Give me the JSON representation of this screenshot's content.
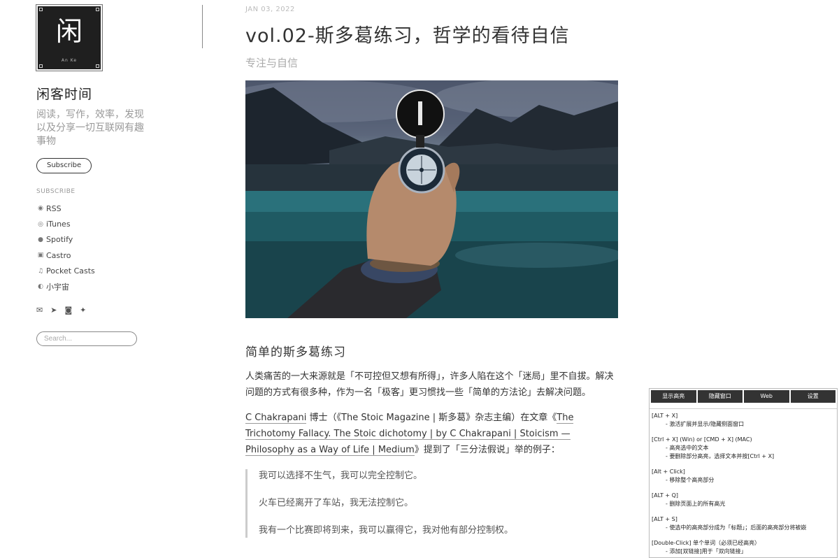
{
  "sidebar": {
    "logo": {
      "glyph": "闲",
      "sub": "An Ke"
    },
    "site_title": "闲客时间",
    "site_description": "阅读，写作，效率，发现以及分享一切互联网有趣事物",
    "subscribe_button": "Subscribe",
    "subscribe_heading": "SUBSCRIBE",
    "subscribe_links": [
      {
        "label": "RSS",
        "icon": "rss-icon"
      },
      {
        "label": "iTunes",
        "icon": "podcast-icon"
      },
      {
        "label": "Spotify",
        "icon": "spotify-icon"
      },
      {
        "label": "Castro",
        "icon": "castro-icon"
      },
      {
        "label": "Pocket Casts",
        "icon": "music-note-icon"
      },
      {
        "label": "小宇宙",
        "icon": "planet-icon"
      }
    ],
    "social_icons": [
      "mail-icon",
      "telegram-icon",
      "instagram-icon",
      "twitter-icon"
    ],
    "search_placeholder": "Search..."
  },
  "article": {
    "date": "JAN 03, 2022",
    "title": "vol.02-斯多葛练习，哲学的看待自信",
    "subtitle": "专注与自信",
    "hero_image": "compass-in-hand-over-mountain-lake",
    "heading": "简单的斯多葛练习",
    "para1": "人类痛苦的一大来源就是「不可控但又想有所得」，许多人陷在这个「迷局」里不自拔。解决问题的方式有很多种，作为一名「极客」更习惯找一些「简单的方法论」去解决问题。",
    "para2": {
      "link1": "C Chakrapani",
      "text1": " 博士（《The Stoic Magazine | 斯多葛》杂志主编）在文章《",
      "link2": "The Trichotomy Fallacy. The Stoic dichotomy | by C Chakrapani | Stoicism — Philosophy as a Way of Life | Medium",
      "text2": "》提到了「三分法假说」举的例子："
    },
    "quotes": [
      "我可以选择不生气，我可以完全控制它。",
      "火车已经离开了车站，我无法控制它。",
      "我有一个比赛即将到来，我可以赢得它，我对他有部分控制权。"
    ]
  },
  "extension_panel": {
    "tabs": [
      "显示高亮",
      "隐藏窗口",
      "Web",
      "设置"
    ],
    "shortcuts": [
      {
        "key": "[ALT + X]",
        "lines": [
          "激活扩展并显示/隐藏侧面窗口"
        ]
      },
      {
        "key": "[Ctrl + X] (Win) or [CMD + X] (MAC)",
        "lines": [
          "高亮选中的文本",
          "要删除部分高亮，选择文本并按[Ctrl + X]"
        ]
      },
      {
        "key": "[Alt + Click]",
        "lines": [
          "移除整个高亮部分"
        ]
      },
      {
        "key": "[ALT + Q]",
        "lines": [
          "删除页面上的所有高光"
        ]
      },
      {
        "key": "[ALT + S]",
        "lines": [
          "使选中的高亮部分成为「标题」；后面的高亮部分将被嵌"
        ]
      },
      {
        "key": "[Double-Click] 单个单词（必须已经高亮）",
        "lines": [
          "添加[双链接]用于「双向链接」"
        ]
      }
    ]
  }
}
